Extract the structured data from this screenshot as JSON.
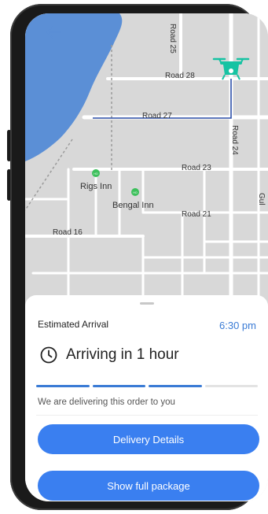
{
  "map": {
    "road_labels": {
      "road25": "Road 25",
      "road28": "Road 28",
      "road27": "Road 27",
      "road24": "Road 24",
      "road23": "Road 23",
      "road21": "Road 21",
      "road16": "Road 16",
      "edge": "Gul"
    },
    "poi_labels": {
      "rigs_inn": "Rigs Inn",
      "bengal_inn": "Bengal Inn"
    },
    "colors": {
      "water": "#5b8fd6",
      "land": "#d8d8d8",
      "roads": "#ffffff",
      "route": "#2c4fa8",
      "drone": "#17c3a3",
      "poi": "#3cc05b"
    }
  },
  "sheet": {
    "eta_label": "Estimated Arrival",
    "eta_time": "6:30 pm",
    "arriving_text": "Arriving in 1 hour",
    "progress": {
      "completed_steps": 3,
      "total_steps": 4
    },
    "delivery_message": "We are delivering this order to you",
    "delivery_details_button": "Delivery Details",
    "show_package_button": "Show full package"
  },
  "icons": {
    "back": "back-arrow-icon",
    "drone": "drone-icon",
    "clock": "clock-icon",
    "poi": "poi-marker-icon"
  },
  "colors": {
    "accent": "#3a7ff0",
    "eta_time": "#3a7bd5"
  }
}
